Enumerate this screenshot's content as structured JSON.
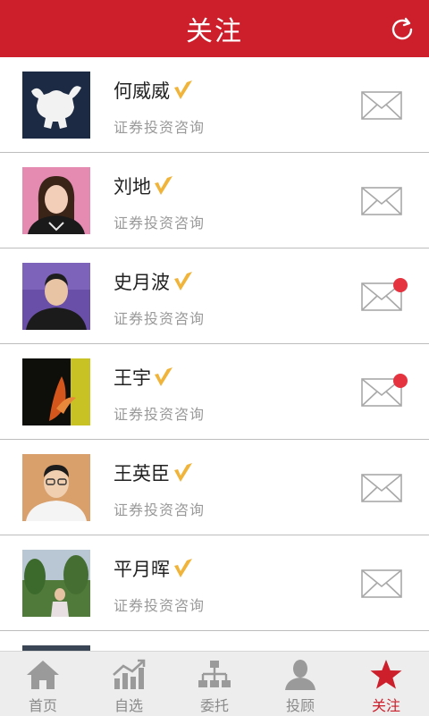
{
  "header": {
    "title": "关注",
    "refresh_icon": "refresh-icon"
  },
  "colors": {
    "brand": "#cc1f2b",
    "unread": "#e53340",
    "badge": "#f0b43a"
  },
  "contacts": [
    {
      "name": "何威威",
      "subtitle": "证券投资咨询",
      "verified": true,
      "unread": false,
      "avatar": "bull-logo"
    },
    {
      "name": "刘地",
      "subtitle": "证券投资咨询",
      "verified": true,
      "unread": false,
      "avatar": "woman-portrait"
    },
    {
      "name": "史月波",
      "subtitle": "证券投资咨询",
      "verified": true,
      "unread": true,
      "avatar": "man-portrait-purple"
    },
    {
      "name": "王宇",
      "subtitle": "证券投资咨询",
      "verified": true,
      "unread": true,
      "avatar": "dark-artwork"
    },
    {
      "name": "王英臣",
      "subtitle": "证券投资咨询",
      "verified": true,
      "unread": false,
      "avatar": "man-glasses-portrait"
    },
    {
      "name": "平月晖",
      "subtitle": "证券投资咨询",
      "verified": true,
      "unread": false,
      "avatar": "garden-photo"
    }
  ],
  "tabs": [
    {
      "label": "首页",
      "icon": "home-icon",
      "active": false
    },
    {
      "label": "自选",
      "icon": "stock-chart-icon",
      "active": false
    },
    {
      "label": "委托",
      "icon": "org-chart-icon",
      "active": false
    },
    {
      "label": "投顾",
      "icon": "advisor-person-icon",
      "active": false
    },
    {
      "label": "关注",
      "icon": "star-icon",
      "active": true
    }
  ]
}
